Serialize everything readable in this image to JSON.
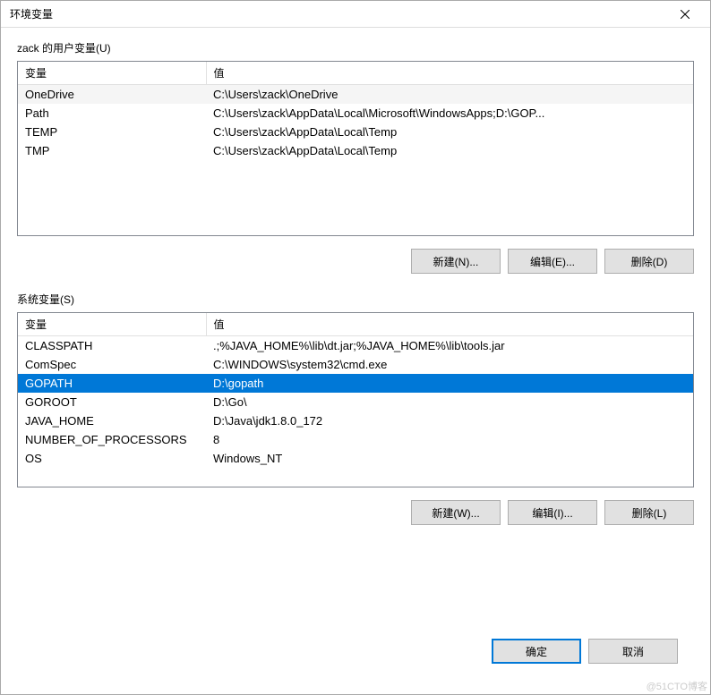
{
  "window": {
    "title": "环境变量"
  },
  "user_section": {
    "label": "zack 的用户变量(U)",
    "headers": {
      "name": "变量",
      "value": "值"
    },
    "rows": [
      {
        "name": "OneDrive",
        "value": "C:\\Users\\zack\\OneDrive"
      },
      {
        "name": "Path",
        "value": "C:\\Users\\zack\\AppData\\Local\\Microsoft\\WindowsApps;D:\\GOP..."
      },
      {
        "name": "TEMP",
        "value": "C:\\Users\\zack\\AppData\\Local\\Temp"
      },
      {
        "name": "TMP",
        "value": "C:\\Users\\zack\\AppData\\Local\\Temp"
      }
    ],
    "buttons": {
      "new": "新建(N)...",
      "edit": "编辑(E)...",
      "delete": "删除(D)"
    }
  },
  "system_section": {
    "label": "系统变量(S)",
    "headers": {
      "name": "变量",
      "value": "值"
    },
    "rows": [
      {
        "name": "CLASSPATH",
        "value": ".;%JAVA_HOME%\\lib\\dt.jar;%JAVA_HOME%\\lib\\tools.jar"
      },
      {
        "name": "ComSpec",
        "value": "C:\\WINDOWS\\system32\\cmd.exe"
      },
      {
        "name": "GOPATH",
        "value": "D:\\gopath",
        "selected": true
      },
      {
        "name": "GOROOT",
        "value": "D:\\Go\\"
      },
      {
        "name": "JAVA_HOME",
        "value": "D:\\Java\\jdk1.8.0_172"
      },
      {
        "name": "NUMBER_OF_PROCESSORS",
        "value": "8"
      },
      {
        "name": "OS",
        "value": "Windows_NT"
      }
    ],
    "buttons": {
      "new": "新建(W)...",
      "edit": "编辑(I)...",
      "delete": "删除(L)"
    }
  },
  "footer": {
    "ok": "确定",
    "cancel": "取消"
  },
  "watermark": "@51CTO博客"
}
